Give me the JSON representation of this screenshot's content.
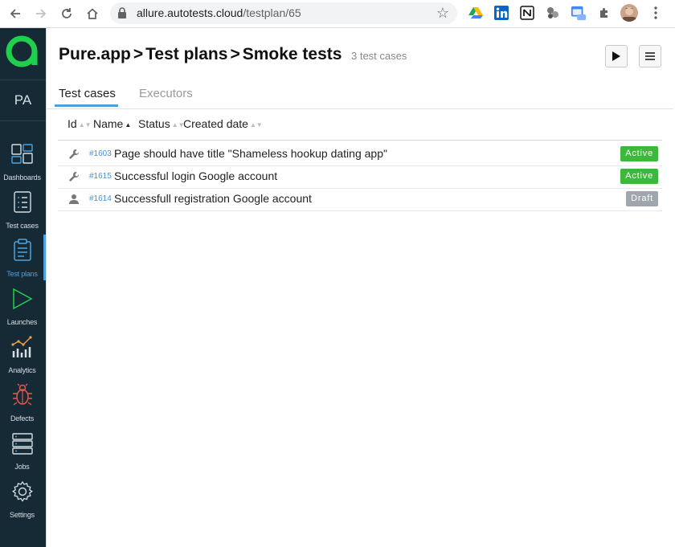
{
  "browser": {
    "url_host": "allure.autotests.cloud",
    "url_path": "/testplan/65"
  },
  "sidebar": {
    "avatar": "PA",
    "items": [
      {
        "label": "Dashboards"
      },
      {
        "label": "Test cases"
      },
      {
        "label": "Test plans"
      },
      {
        "label": "Launches"
      },
      {
        "label": "Analytics"
      },
      {
        "label": "Defects"
      },
      {
        "label": "Jobs"
      },
      {
        "label": "Settings"
      }
    ]
  },
  "header": {
    "project": "Pure.app",
    "section": "Test plans",
    "plan": "Smoke tests",
    "sep": ">",
    "count": "3 test cases"
  },
  "tabs": [
    {
      "label": "Test cases"
    },
    {
      "label": "Executors"
    }
  ],
  "columns": [
    "Id",
    "Name",
    "Status",
    "Created date"
  ],
  "rows": [
    {
      "icon": "wrench-icon",
      "id": "#1603",
      "name": "Page should have title \"Shameless hookup dating app\"",
      "status": "Active"
    },
    {
      "icon": "wrench-icon",
      "id": "#1615",
      "name": "Successful login Google account",
      "status": "Active"
    },
    {
      "icon": "user-icon",
      "id": "#1614",
      "name": "Successfull registration Google account",
      "status": "Draft"
    }
  ],
  "colors": {
    "sidebar_bg": "#162a36",
    "accent": "#4aa3df",
    "logo": "#1fd14a",
    "active_badge": "#3cb93c",
    "draft_badge": "#9fa6ad"
  }
}
